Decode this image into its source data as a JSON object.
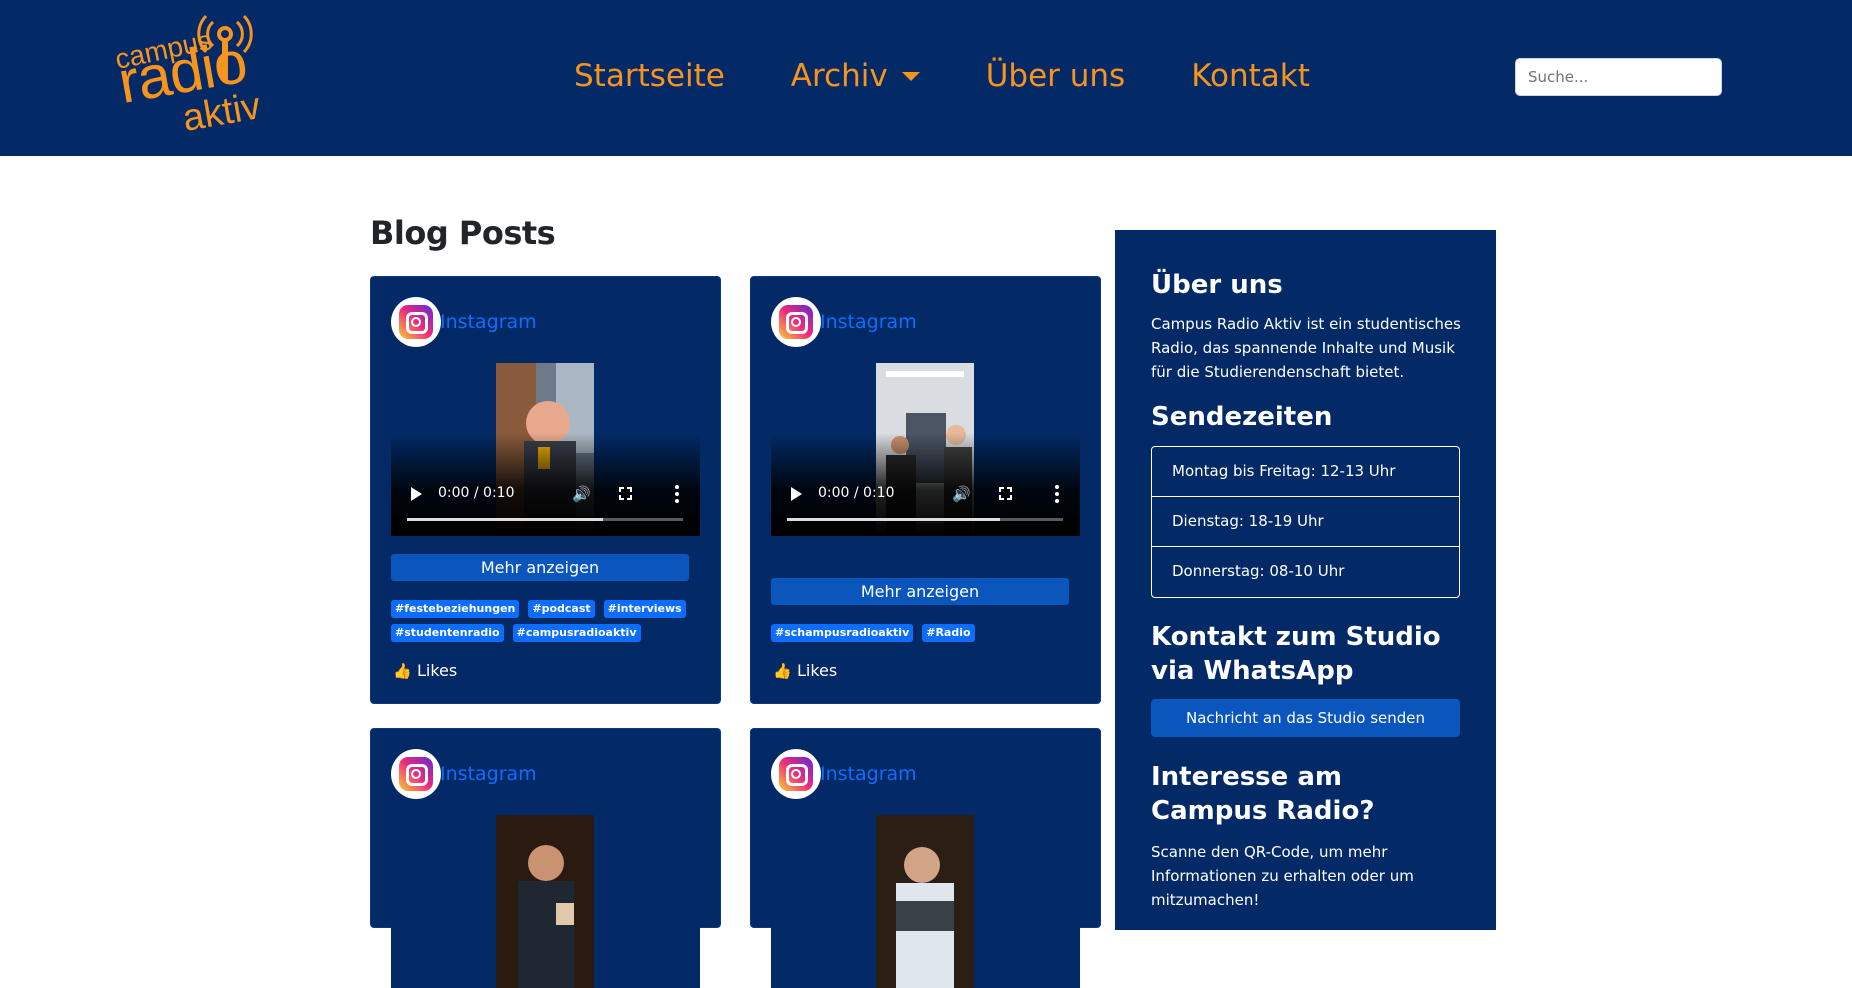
{
  "header": {
    "logo": {
      "line1": "campus",
      "line2": "radio",
      "line3": "aktiv"
    },
    "nav": [
      {
        "label": "Startseite"
      },
      {
        "label": "Archiv"
      },
      {
        "label": "Über uns"
      },
      {
        "label": "Kontakt"
      }
    ],
    "search": {
      "placeholder": "Suche...",
      "value": ""
    }
  },
  "main": {
    "title": "Blog Posts",
    "posts": [
      {
        "source": "Instagram",
        "video_time": "0:00 / 0:10",
        "progress": 0.71,
        "more_label": "Mehr anzeigen",
        "tags": [
          "#festebeziehungen",
          "#podcast",
          "#interviews",
          "#studentenradio",
          "#campusradioaktiv"
        ],
        "likes_label": "Likes"
      },
      {
        "source": "Instagram",
        "video_time": "0:00 / 0:10",
        "progress": 0.77,
        "more_label": "Mehr anzeigen",
        "tags": [
          "#schampusradioaktiv",
          "#Radio"
        ],
        "likes_label": "Likes"
      },
      {
        "source": "Instagram"
      },
      {
        "source": "Instagram"
      }
    ]
  },
  "sidebar": {
    "about_title": "Über uns",
    "about_text": "Campus Radio Aktiv ist ein studentisches Radio, das spannende Inhalte und Musik für die Studierendenschaft bietet.",
    "schedule_title": "Sendezeiten",
    "schedule": [
      "Montag bis Freitag: 12-13 Uhr",
      "Dienstag: 18-19 Uhr",
      "Donnerstag: 08-10 Uhr"
    ],
    "whatsapp_title": "Kontakt zum Studio via WhatsApp",
    "whatsapp_button": "Nachricht an das Studio senden",
    "interest_title": "Interesse am Campus Radio?",
    "interest_text": "Scanne den QR-Code, um mehr Informationen zu erhalten oder um mitzumachen!"
  },
  "colors": {
    "navy": "#032a66",
    "orange": "#f7941d",
    "link_blue": "#0d6efd",
    "button_blue": "#0b56bd"
  }
}
